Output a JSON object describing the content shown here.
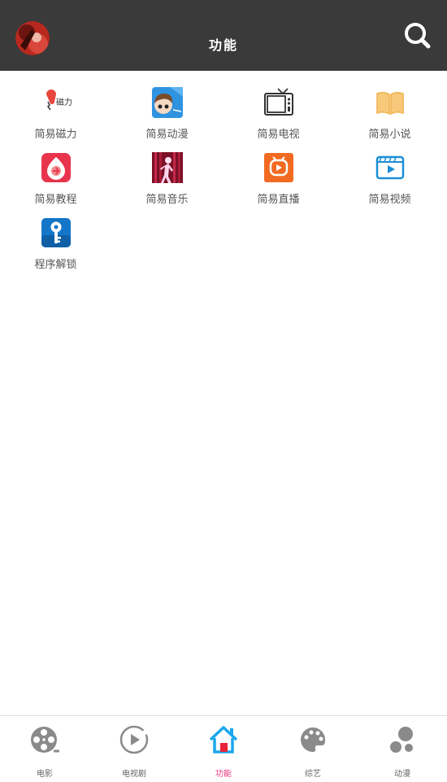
{
  "header": {
    "title": "功能",
    "avatar_icon": "avatar-portrait",
    "search_icon": "search-icon"
  },
  "functions": [
    {
      "label": "简易磁力",
      "icon": "magnet-icon",
      "icon_text": "磁力"
    },
    {
      "label": "简易动漫",
      "icon": "anime-icon"
    },
    {
      "label": "简易电视",
      "icon": "tv-icon"
    },
    {
      "label": "简易小说",
      "icon": "book-icon"
    },
    {
      "label": "简易教程",
      "icon": "tutorial-icon"
    },
    {
      "label": "简易音乐",
      "icon": "music-icon"
    },
    {
      "label": "简易直播",
      "icon": "live-tv-icon"
    },
    {
      "label": "简易视频",
      "icon": "video-icon"
    },
    {
      "label": "程序解锁",
      "icon": "unlock-key-icon"
    }
  ],
  "tabs": [
    {
      "label": "电影",
      "icon": "film-reel-icon"
    },
    {
      "label": "电视剧",
      "icon": "play-circle-icon"
    },
    {
      "label": "功能",
      "icon": "home-icon",
      "active": true
    },
    {
      "label": "综艺",
      "icon": "palette-icon"
    },
    {
      "label": "动漫",
      "icon": "bubbles-icon"
    }
  ],
  "colors": {
    "header_bg": "#3a3a3a",
    "active_tab": "#e8387e",
    "home_icon": "#1aa7ec"
  }
}
